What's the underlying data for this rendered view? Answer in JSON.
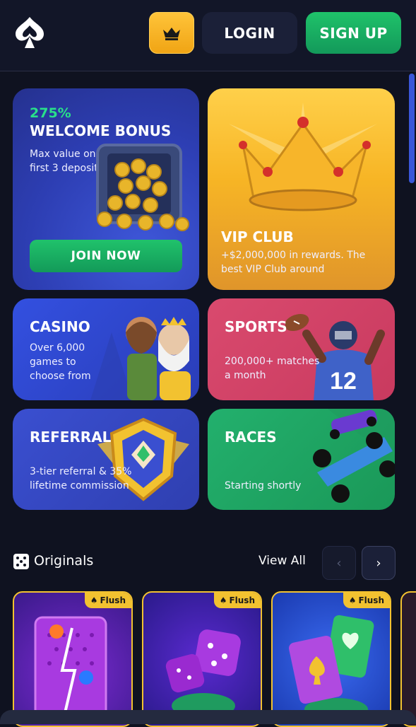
{
  "header": {
    "login_label": "LOGIN",
    "signup_label": "SIGN UP",
    "icons": {
      "logo": "spade-logo-icon",
      "crown": "crown-icon"
    }
  },
  "promos": {
    "welcome": {
      "percent": "275%",
      "title": "WELCOME BONUS",
      "sub_line1": "Max value on",
      "sub_line2": "first 3 deposits",
      "button": "JOIN NOW"
    },
    "vip": {
      "title": "VIP CLUB",
      "sub_line1": "+$2,000,000 in rewards. The",
      "sub_line2": "best VIP Club around"
    },
    "casino": {
      "title": "CASINO",
      "sub_line1": "Over 6,000",
      "sub_line2": "games to",
      "sub_line3": "choose from"
    },
    "sports": {
      "title": "SPORTS",
      "sub_line1": "200,000+ matches",
      "sub_line2": "a month",
      "jersey_number": "12"
    },
    "referral": {
      "title": "REFERRAL",
      "sub_line1": "3-tier referral & 35%",
      "sub_line2": "lifetime commission"
    },
    "races": {
      "title": "RACES",
      "sub_line1": "Starting shortly"
    }
  },
  "originals": {
    "title": "Originals",
    "view_all": "View All",
    "prev_icon": "chevron-left-icon",
    "next_icon": "chevron-right-icon",
    "badge_label": "Flush",
    "games": [
      "plinko",
      "dice",
      "cards"
    ]
  },
  "colors": {
    "bg": "#0f1220",
    "accent_green": "#1fc26a",
    "accent_gold": "#f2c230",
    "accent_blue": "#3a57d8"
  }
}
